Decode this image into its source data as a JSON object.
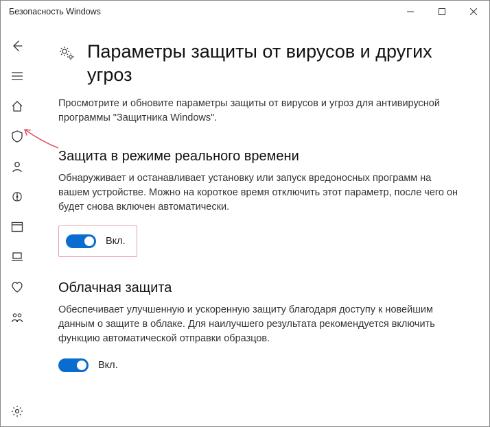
{
  "window": {
    "title": "Безопасность Windows"
  },
  "page": {
    "title": "Параметры защиты от вирусов и других угроз",
    "subtitle": "Просмотрите и обновите параметры защиты от вирусов и угроз для антивирусной программы \"Защитника Windows\"."
  },
  "sections": {
    "realtime": {
      "title": "Защита в режиме реального времени",
      "desc": "Обнаруживает и останавливает установку или запуск вредоносных программ на вашем устройстве. Можно на короткое время отключить этот параметр, после чего он будет снова включен автоматически.",
      "toggle_label": "Вкл.",
      "toggle_on": true
    },
    "cloud": {
      "title": "Облачная защита",
      "desc": "Обеспечивает улучшенную и ускоренную защиту благодаря доступу к новейшим данным о защите в облаке. Для наилучшего результата рекомендуется включить функцию автоматической отправки образцов.",
      "toggle_label": "Вкл.",
      "toggle_on": true
    }
  }
}
